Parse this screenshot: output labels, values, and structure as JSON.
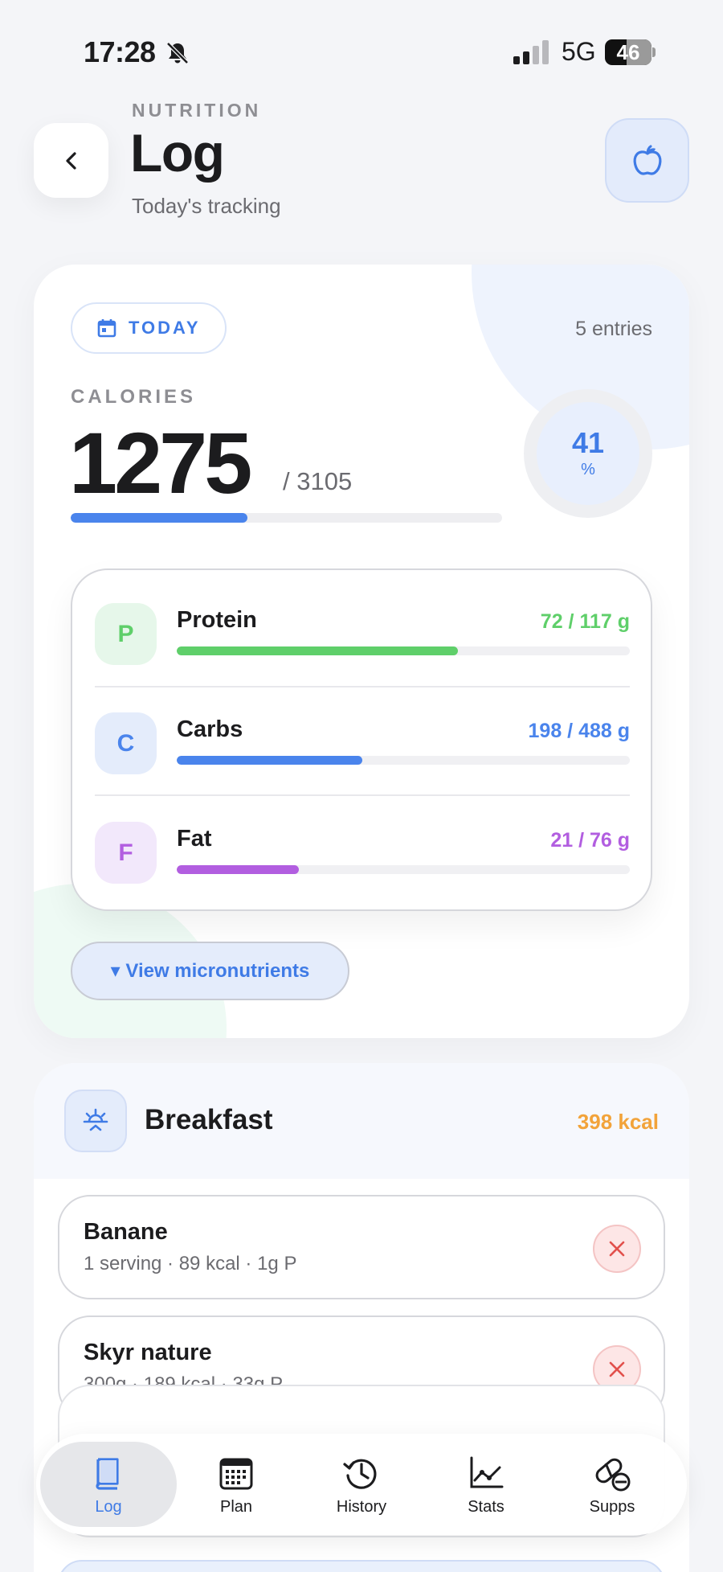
{
  "status_bar": {
    "time": "17:28",
    "network": "5G",
    "battery": "46",
    "battery_level": 0.46
  },
  "header": {
    "eyebrow": "NUTRITION",
    "title": "Log",
    "subtitle": "Today's tracking"
  },
  "summary": {
    "date_chip": "TODAY",
    "entries": "5 entries",
    "calories_label": "CALORIES",
    "calories_value": "1275",
    "calories_goal": "/ 3105",
    "calories_progress": 0.41,
    "ring_value": "41",
    "ring_unit": "%",
    "macros": [
      {
        "letter": "P",
        "name": "Protein",
        "amount": "72 / 117 g",
        "progress": 0.62,
        "color": "#5fcf6a",
        "badge_bg": "#e6f7ea"
      },
      {
        "letter": "C",
        "name": "Carbs",
        "amount": "198 / 488 g",
        "progress": 0.41,
        "color": "#4a84ec",
        "badge_bg": "#e4ecfb"
      },
      {
        "letter": "F",
        "name": "Fat",
        "amount": "21 / 76 g",
        "progress": 0.27,
        "color": "#b25ee0",
        "badge_bg": "#f2e8fb"
      }
    ],
    "micronutrients_button": "▾ View micronutrients"
  },
  "meal": {
    "title": "Breakfast",
    "kcal": "398 kcal",
    "items": [
      {
        "name": "Banane",
        "meta": "1 serving · 89 kcal · 1g P"
      },
      {
        "name": "Skyr nature",
        "meta": "300g · 189 kcal · 33g P"
      }
    ]
  },
  "tabs": [
    {
      "label": "Log",
      "icon": "book-icon",
      "active": true
    },
    {
      "label": "Plan",
      "icon": "calendar-icon",
      "active": false
    },
    {
      "label": "History",
      "icon": "history-icon",
      "active": false
    },
    {
      "label": "Stats",
      "icon": "chart-icon",
      "active": false
    },
    {
      "label": "Supps",
      "icon": "pill-icon",
      "active": false
    }
  ],
  "colors": {
    "accent": "#3f7be6",
    "protein": "#5fcf6a",
    "carbs": "#4a84ec",
    "fat": "#b25ee0",
    "kcal": "#f2a33a",
    "remove": "#e2504c"
  }
}
